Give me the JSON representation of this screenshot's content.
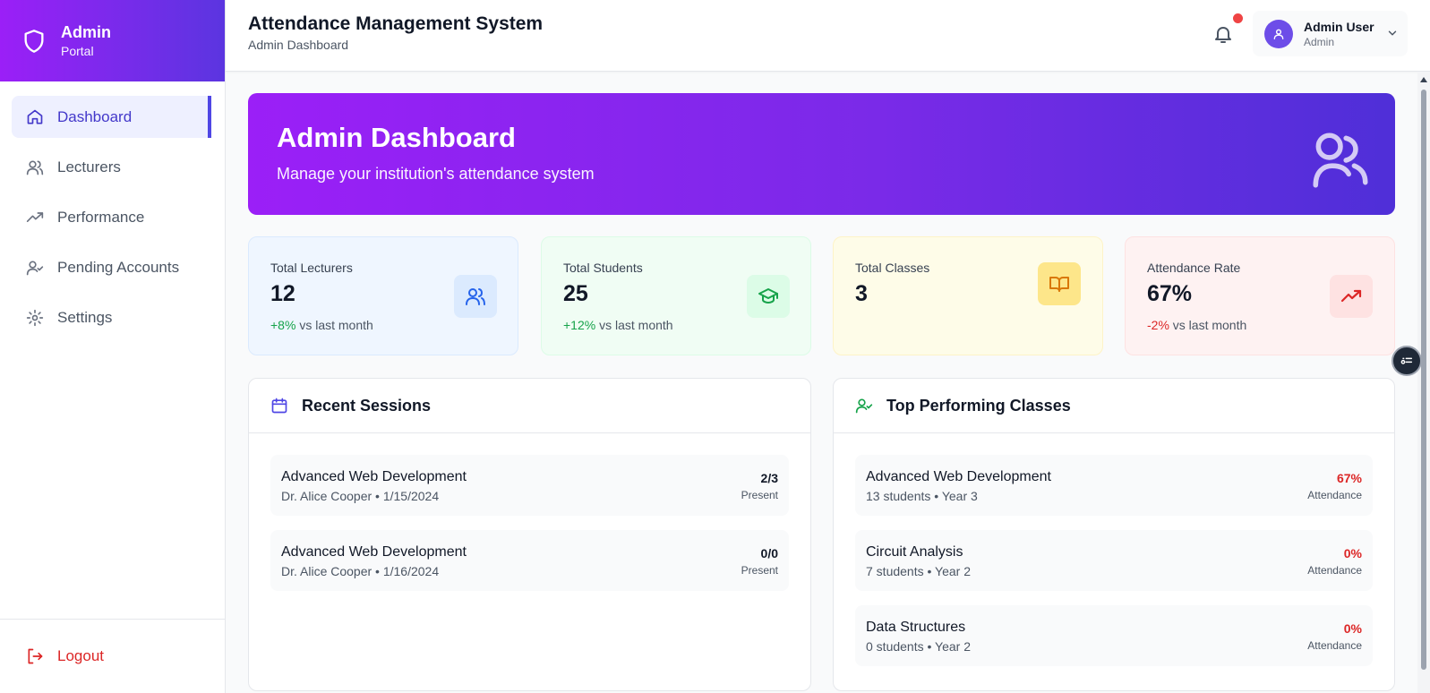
{
  "brand": {
    "title": "Admin",
    "subtitle": "Portal",
    "icon": "shield-icon"
  },
  "sidebar": {
    "items": [
      {
        "label": "Dashboard",
        "icon": "home-icon",
        "active": true
      },
      {
        "label": "Lecturers",
        "icon": "users-icon",
        "active": false
      },
      {
        "label": "Performance",
        "icon": "trending-up-icon",
        "active": false
      },
      {
        "label": "Pending Accounts",
        "icon": "user-check-icon",
        "active": false
      },
      {
        "label": "Settings",
        "icon": "gear-icon",
        "active": false
      }
    ],
    "logout": "Logout"
  },
  "header": {
    "title": "Attendance Management System",
    "subtitle": "Admin Dashboard",
    "user_name": "Admin User",
    "user_role": "Admin"
  },
  "hero": {
    "title": "Admin Dashboard",
    "subtitle": "Manage your institution's attendance system"
  },
  "stats": [
    {
      "label": "Total Lecturers",
      "value": "12",
      "change": "+8%",
      "change_suffix": "vs last month",
      "icon": "users-icon"
    },
    {
      "label": "Total Students",
      "value": "25",
      "change": "+12%",
      "change_suffix": "vs last month",
      "icon": "graduation-cap-icon"
    },
    {
      "label": "Total Classes",
      "value": "3",
      "icon": "book-open-icon"
    },
    {
      "label": "Attendance Rate",
      "value": "67%",
      "change": "-2%",
      "change_suffix": "vs last month",
      "icon": "trending-up-icon"
    }
  ],
  "recent_sessions": {
    "title": "Recent Sessions",
    "items": [
      {
        "title": "Advanced Web Development",
        "meta": "Dr. Alice Cooper • 1/15/2024",
        "value": "2/3",
        "caption": "Present"
      },
      {
        "title": "Advanced Web Development",
        "meta": "Dr. Alice Cooper • 1/16/2024",
        "value": "0/0",
        "caption": "Present"
      }
    ]
  },
  "top_classes": {
    "title": "Top Performing Classes",
    "items": [
      {
        "title": "Advanced Web Development",
        "meta": "13 students • Year 3",
        "value": "67%",
        "caption": "Attendance"
      },
      {
        "title": "Circuit Analysis",
        "meta": "7 students • Year 2",
        "value": "0%",
        "caption": "Attendance"
      },
      {
        "title": "Data Structures",
        "meta": "0 students • Year 2",
        "value": "0%",
        "caption": "Attendance"
      }
    ]
  },
  "colors": {
    "brand_gradient_start": "#9b1ff7",
    "brand_gradient_end": "#4f2fd8",
    "accent": "#4f46e5",
    "positive": "#16a34a",
    "negative": "#dc2626"
  }
}
